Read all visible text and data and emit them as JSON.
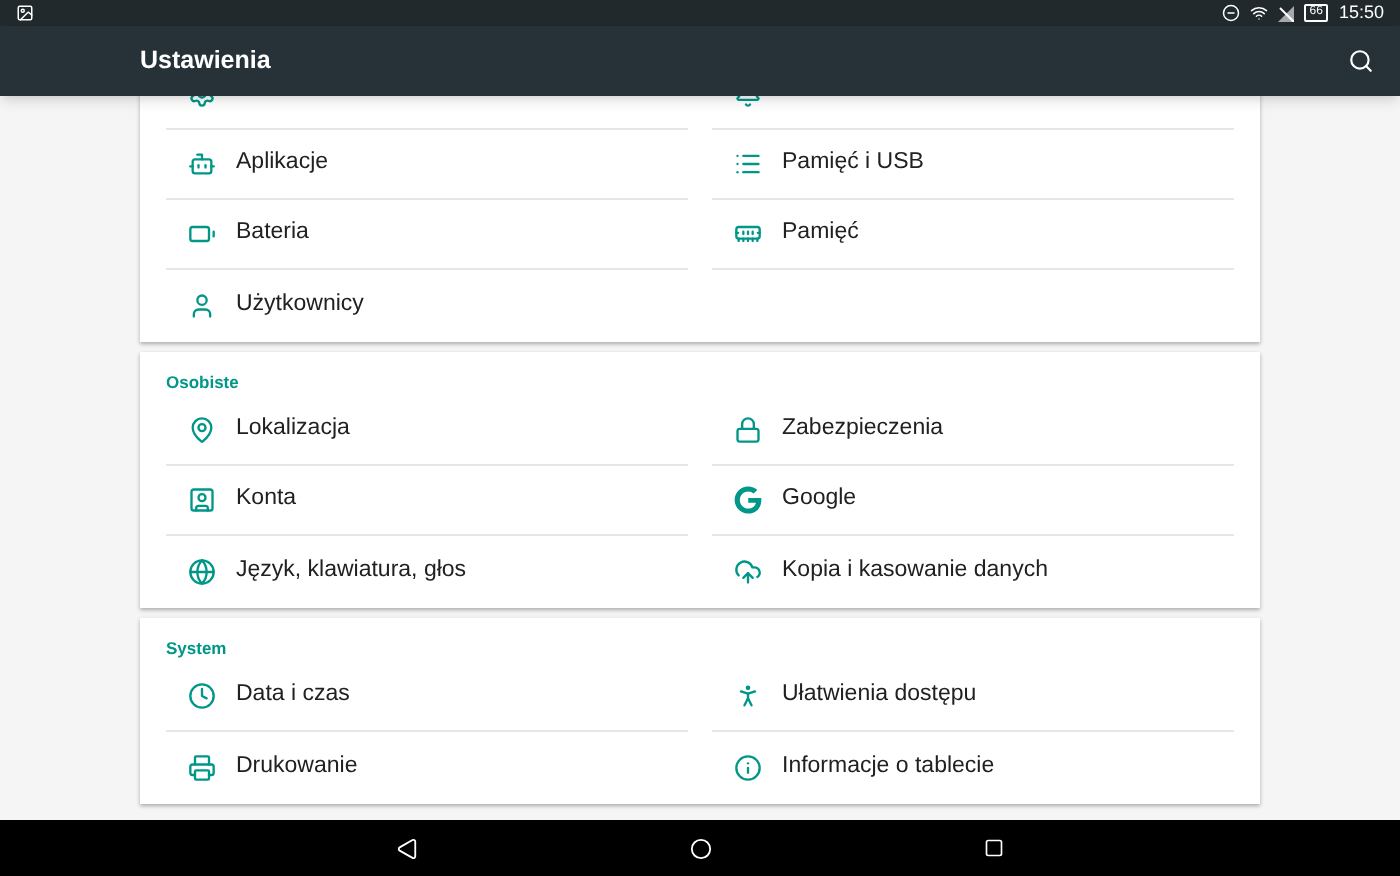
{
  "status_bar": {
    "battery_text": "66",
    "time": "15:50"
  },
  "app_bar": {
    "title": "Ustawienia"
  },
  "sections": [
    {
      "items": [
        {
          "kind": "covered"
        },
        {
          "kind": "covered"
        },
        {
          "label": "Aplikacje"
        },
        {
          "label": "Pamięć i USB"
        },
        {
          "label": "Bateria"
        },
        {
          "label": "Pamięć"
        },
        {
          "label": "Użytkownicy"
        }
      ]
    },
    {
      "header": "Osobiste",
      "items": [
        {
          "label": "Lokalizacja"
        },
        {
          "label": "Zabezpieczenia"
        },
        {
          "label": "Konta"
        },
        {
          "label": "Google"
        },
        {
          "label": "Język, klawiatura, głos"
        },
        {
          "label": "Kopia i kasowanie danych"
        }
      ]
    },
    {
      "header": "System",
      "items": [
        {
          "label": "Data i czas"
        },
        {
          "label": "Ułatwienia dostępu"
        },
        {
          "label": "Drukowanie"
        },
        {
          "label": "Informacje o tablecie"
        }
      ]
    }
  ]
}
